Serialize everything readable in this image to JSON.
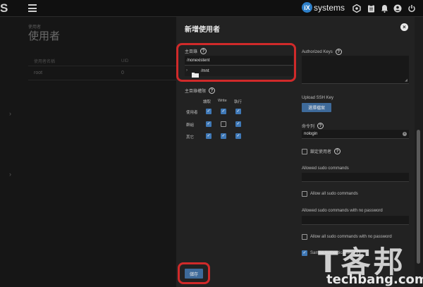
{
  "topbar": {
    "logo_fragment": "S",
    "brand_text": "systems",
    "brand_badge": "iX"
  },
  "background": {
    "breadcrumb": "使用者",
    "title": "使用者",
    "table_headers": [
      "使用者名稱",
      "UID"
    ],
    "table_rows": [
      {
        "name": "root",
        "uid": "0"
      }
    ]
  },
  "dialog": {
    "title": "新增使用者",
    "home_dir": {
      "label": "主目錄",
      "value": "/nonexistent",
      "tree_item": "/mnt"
    },
    "home_perm": {
      "label": "主目錄權限",
      "columns": [
        "讀取",
        "Write",
        "執行"
      ],
      "rows": [
        {
          "label": "使用者",
          "read": true,
          "write": true,
          "exec": true
        },
        {
          "label": "群組",
          "read": true,
          "write": false,
          "exec": true
        },
        {
          "label": "其它",
          "read": true,
          "write": true,
          "exec": true
        }
      ]
    },
    "authorized_keys": {
      "label": "Authorized Keys",
      "value": ""
    },
    "upload_ssh": {
      "label": "Upload SSH Key",
      "button": "選擇檔案"
    },
    "shell": {
      "label": "命令列",
      "value": "nologin"
    },
    "lock_user": {
      "label": "鎖定使用者",
      "checked": false
    },
    "sudo_commands": {
      "label": "Allowed sudo commands",
      "value": ""
    },
    "allow_all_sudo": {
      "label": "Allow all sudo commands",
      "checked": false
    },
    "sudo_nopass": {
      "label": "Allowed sudo commands with no password",
      "value": ""
    },
    "allow_all_sudo_nopass": {
      "label": "Allow all sudo commands with no password",
      "checked": false
    },
    "samba_auth": {
      "label": "Samba Authentication",
      "checked": true
    },
    "save_button": "儲存"
  },
  "watermark": {
    "big": "T客邦",
    "small": "techbang.com"
  },
  "colors": {
    "accent": "#3e6a9a",
    "highlight": "#d02a2a",
    "checkbox_on": "#3f78b6"
  },
  "icons": [
    "menu-icon",
    "truecommand-icon",
    "clipboard-icon",
    "bell-icon",
    "account-icon",
    "power-icon",
    "help-icon",
    "close-icon",
    "folder-icon",
    "chevron-right-icon",
    "clear-icon"
  ]
}
